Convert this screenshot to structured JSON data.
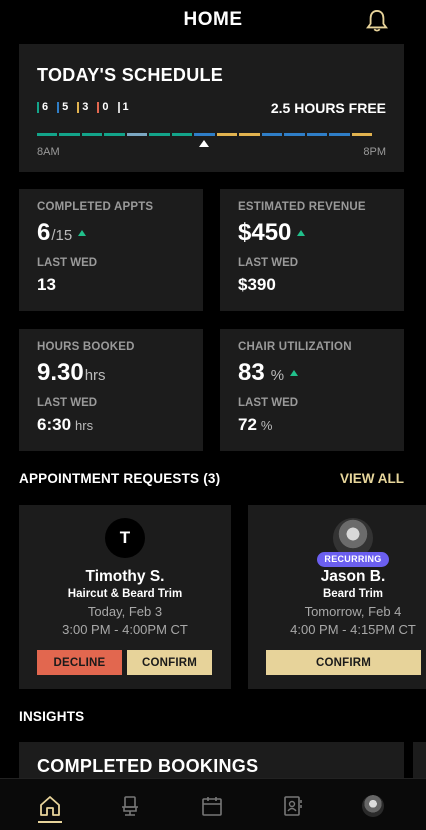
{
  "header": {
    "title": "HOME",
    "bell_icon": "bell-icon"
  },
  "colors": {
    "accent_gold": "#e7d39a",
    "teal": "#13a48a",
    "blue": "#2f7ec7",
    "orange": "#e2674f",
    "up_green": "#21c08b",
    "purple": "#6b5ff0"
  },
  "schedule": {
    "title": "TODAY'S SCHEDULE",
    "legend": [
      {
        "value": "6",
        "color": "#13a48a"
      },
      {
        "value": "5",
        "color": "#2f7ec7"
      },
      {
        "value": "3",
        "color": "#e2b34f"
      },
      {
        "value": "0",
        "color": "#e2674f"
      },
      {
        "value": "1",
        "color": "#cfcfcf"
      }
    ],
    "free_text": "2.5 HOURS FREE",
    "start_label": "8AM",
    "end_label": "8PM",
    "segments": [
      "#13a48a",
      "#13a48a",
      "#13a48a",
      "#13a48a",
      "#7ba7c2",
      "#13a48a",
      "#13a48a",
      "#2f7ec7",
      "#e2b34f",
      "#e2b34f",
      "#2f7ec7",
      "#2f7ec7",
      "#2f7ec7",
      "#2f7ec7",
      "#e2b34f"
    ]
  },
  "stats": {
    "completed": {
      "label": "COMPLETED APPTS",
      "value": "6",
      "suffix": "/15",
      "prev_label": "LAST WED",
      "prev_value": "13"
    },
    "revenue": {
      "label": "ESTIMATED REVENUE",
      "value": "$450",
      "prev_label": "LAST WED",
      "prev_value": "$390"
    },
    "hours": {
      "label": "HOURS BOOKED",
      "value": "9.30",
      "suffix": "hrs",
      "prev_label": "LAST WED",
      "prev_value": "6:30",
      "prev_suffix": "hrs"
    },
    "chair": {
      "label": "CHAIR UTILIZATION",
      "value": "83",
      "suffix": "%",
      "prev_label": "LAST WED",
      "prev_value": "72",
      "prev_suffix": "%"
    }
  },
  "requests": {
    "title": "APPOINTMENT REQUESTS (3)",
    "view_all": "VIEW ALL",
    "items": [
      {
        "initial": "T",
        "name": "Timothy S.",
        "service": "Haircut & Beard Trim",
        "date": "Today, Feb 3",
        "time": "3:00 PM - 4:00PM CT",
        "decline": "DECLINE",
        "confirm": "CONFIRM"
      },
      {
        "badge": "RECURRING",
        "name": "Jason B.",
        "service": "Beard Trim",
        "date": "Tomorrow, Feb 4",
        "time": "4:00 PM - 4:15PM CT",
        "confirm": "CONFIRM"
      }
    ]
  },
  "insights": {
    "title": "INSIGHTS",
    "card_title": "COMPLETED BOOKINGS"
  },
  "tabbar": {
    "tabs": [
      {
        "icon": "home-icon",
        "active": true
      },
      {
        "icon": "chair-icon",
        "active": false
      },
      {
        "icon": "calendar-icon",
        "active": false
      },
      {
        "icon": "contacts-icon",
        "active": false
      },
      {
        "icon": "profile-avatar",
        "active": false
      }
    ]
  }
}
